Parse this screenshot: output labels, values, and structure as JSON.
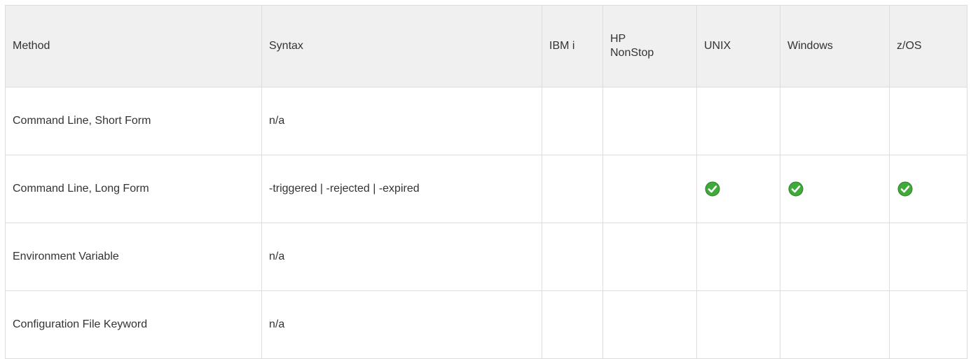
{
  "headers": {
    "method": "Method",
    "syntax": "Syntax",
    "ibmi": "IBM i",
    "hp_line1": "HP",
    "hp_line2": "NonStop",
    "unix": "UNIX",
    "windows": "Windows",
    "zos": "z/OS"
  },
  "rows": [
    {
      "method": "Command Line, Short Form",
      "syntax": "n/a",
      "ibmi": false,
      "hp_nonstop": false,
      "unix": false,
      "windows": false,
      "zos": false
    },
    {
      "method": "Command Line, Long Form",
      "syntax": "-triggered | -rejected | -expired",
      "ibmi": false,
      "hp_nonstop": false,
      "unix": true,
      "windows": true,
      "zos": true
    },
    {
      "method": "Environment Variable",
      "syntax": "n/a",
      "ibmi": false,
      "hp_nonstop": false,
      "unix": false,
      "windows": false,
      "zos": false
    },
    {
      "method": "Configuration File Keyword",
      "syntax": "n/a",
      "ibmi": false,
      "hp_nonstop": false,
      "unix": false,
      "windows": false,
      "zos": false
    }
  ],
  "icons": {
    "supported": "check-icon",
    "check_color": "#3fa93a"
  }
}
